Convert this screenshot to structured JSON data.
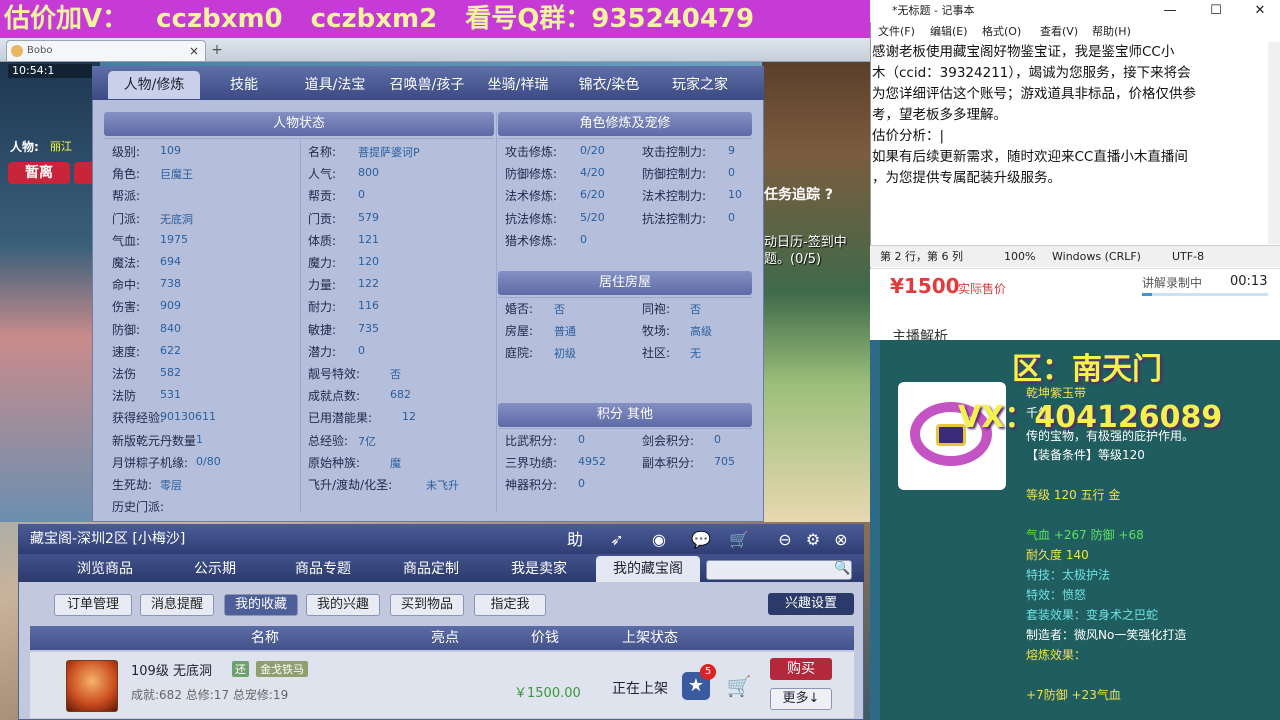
{
  "banner": {
    "p1": "估价加V：",
    "p2": "cczbxm0",
    "p3": "cczbxm2",
    "p4": "看号Q群：935240479"
  },
  "browser": {
    "tab_title": "Bobo",
    "tab_close": "×",
    "new_tab": "+"
  },
  "game": {
    "time": "10:54:1",
    "player_label": "人物:",
    "player_value": "丽江",
    "pause_button": "暂离",
    "task_label": "任务追踪 ?",
    "calendar_text": "动日历-签到中\n题。(0/5)"
  },
  "char_panel": {
    "tabs": [
      "人物/修炼",
      "技能",
      "道具/法宝",
      "召唤兽/孩子",
      "坐骑/祥瑞",
      "锦衣/染色",
      "玩家之家"
    ],
    "status_header": "人物状态",
    "cultivation_header": "角色修炼及宠修",
    "housing_header": "居住房屋",
    "points_header": "积分 其他",
    "left_col": [
      {
        "label": "级别:",
        "value": "109"
      },
      {
        "label": "角色:",
        "value": "巨魔王"
      },
      {
        "label": "帮派:",
        "value": ""
      },
      {
        "label": "门派:",
        "value": "无底洞"
      },
      {
        "label": "气血:",
        "value": "1975"
      },
      {
        "label": "魔法:",
        "value": "694"
      },
      {
        "label": "命中:",
        "value": "738"
      },
      {
        "label": "伤害:",
        "value": "909"
      },
      {
        "label": "防御:",
        "value": "840"
      },
      {
        "label": "速度:",
        "value": "622"
      },
      {
        "label": "法伤",
        "value": "582"
      },
      {
        "label": "法防",
        "value": "531"
      },
      {
        "label": "获得经验:",
        "value": "90130611"
      },
      {
        "label": "新版乾元丹数量",
        "value": "1"
      },
      {
        "label": "月饼粽子机缘:",
        "value": "0/80"
      },
      {
        "label": "生死劫:",
        "value": "零层"
      },
      {
        "label": "历史门派:",
        "value": ""
      }
    ],
    "mid_col": [
      {
        "label": "名称:",
        "value": "菩提萨婆诃P"
      },
      {
        "label": "人气:",
        "value": "800"
      },
      {
        "label": "帮贡:",
        "value": "0"
      },
      {
        "label": "门贡:",
        "value": "579"
      },
      {
        "label": "体质:",
        "value": "121"
      },
      {
        "label": "魔力:",
        "value": "120"
      },
      {
        "label": "力量:",
        "value": "122"
      },
      {
        "label": "耐力:",
        "value": "116"
      },
      {
        "label": "敏捷:",
        "value": "735"
      },
      {
        "label": "潜力:",
        "value": "0"
      },
      {
        "label": "靓号特效:",
        "value": "否"
      },
      {
        "label": "成就点数:",
        "value": "682"
      },
      {
        "label": "已用潜能果:",
        "value": "12"
      },
      {
        "label": "总经验:",
        "value": "7亿"
      },
      {
        "label": "原始种族:",
        "value": "魔"
      },
      {
        "label": "飞升/渡劫/化圣:",
        "value": "未飞升"
      }
    ],
    "cult_col1": [
      {
        "label": "攻击修炼:",
        "value": "0/20"
      },
      {
        "label": "防御修炼:",
        "value": "4/20"
      },
      {
        "label": "法术修炼:",
        "value": "6/20"
      },
      {
        "label": "抗法修炼:",
        "value": "5/20"
      },
      {
        "label": "猎术修炼:",
        "value": "0"
      }
    ],
    "cult_col2": [
      {
        "label": "攻击控制力:",
        "value": "9"
      },
      {
        "label": "防御控制力:",
        "value": "0"
      },
      {
        "label": "法术控制力:",
        "value": "10"
      },
      {
        "label": "抗法控制力:",
        "value": "0"
      }
    ],
    "housing": [
      {
        "label": "婚否:",
        "value": "否"
      },
      {
        "label": "同袍:",
        "value": "否"
      },
      {
        "label": "房屋:",
        "value": "普通"
      },
      {
        "label": "牧场:",
        "value": "高级"
      },
      {
        "label": "庭院:",
        "value": "初级"
      },
      {
        "label": "社区:",
        "value": "无"
      }
    ],
    "points": [
      {
        "label": "比武积分:",
        "value": "0"
      },
      {
        "label": "剑会积分:",
        "value": "0"
      },
      {
        "label": "三界功绩:",
        "value": "4952"
      },
      {
        "label": "副本积分:",
        "value": "705"
      },
      {
        "label": "神器积分:",
        "value": "0"
      }
    ]
  },
  "store": {
    "title": "藏宝阁-深圳2区 [小梅沙]",
    "help_icon": "助",
    "nav": [
      "浏览商品",
      "公示期",
      "商品专题",
      "商品定制",
      "我是卖家",
      "我的藏宝阁"
    ],
    "subnav": [
      "订单管理",
      "消息提醒",
      "我的收藏",
      "我的兴趣",
      "买到物品",
      "指定我"
    ],
    "interest_settings": "兴趣设置",
    "columns": [
      "名称",
      "亮点",
      "价钱",
      "上架状态"
    ],
    "item": {
      "name": "109级 无底洞",
      "badge1": "还",
      "badge2": "金戈铁马",
      "sub": "成就:682 总修:17 总宠修:19",
      "price": "￥1500.00",
      "status": "正在上架",
      "star_count": "5",
      "buy": "购买",
      "more": "更多↓"
    }
  },
  "notepad": {
    "title": "*无标题 - 记事本",
    "menu": [
      "文件(F)",
      "编辑(E)",
      "格式(O)",
      "查看(V)",
      "帮助(H)"
    ],
    "text": "感谢老板使用藏宝阁好物鉴宝证，我是鉴宝师CC小\n木（ccid：39324211），竭诚为您服务，接下来将会\n为您详细评估这个账号；游戏道具非标品，价格仅供参\n考，望老板多多理解。\n估价分析：|\n如果有后续更新需求，随时欢迎来CC直播小木直播间\n，为您提供专属配装升级服务。",
    "status": {
      "pos": "第 2 行，第 6 列",
      "zoom": "100%",
      "eol": "Windows (CRLF)",
      "enc": "UTF-8"
    }
  },
  "price_bar": {
    "price": "¥1500",
    "label": "实际售价",
    "recording": "讲解录制中",
    "time": "00:13",
    "analysis": "主播解析"
  },
  "item_panel": {
    "zone": "区：南天门",
    "vx": "VX：404126089",
    "item_name": "乾坤紫玉带",
    "desc_line1": "千年",
    "desc_line2": "传的宝物，有极强的庇护作用。",
    "req": "【装备条件】等级120",
    "level": "等级 120  五行 金",
    "attrs": "气血 +267 防御 +68",
    "durability": "耐久度 140",
    "special_skill": "特技：太极护法",
    "special_effect": "特效：愤怒",
    "set_effect": "套装效果：变身术之巴蛇",
    "maker": "制造者：微风No一笑强化打造",
    "refine": "熔炼效果：",
    "refine_val": "+7防御 +23气血"
  },
  "colors": {
    "banner_bg": "#c63ad6",
    "banner_text": "#f3f3a0",
    "price_red": "#e23b3b",
    "overlay_yellow": "#f4f04d",
    "panel_teal": "#1f5d5f"
  }
}
